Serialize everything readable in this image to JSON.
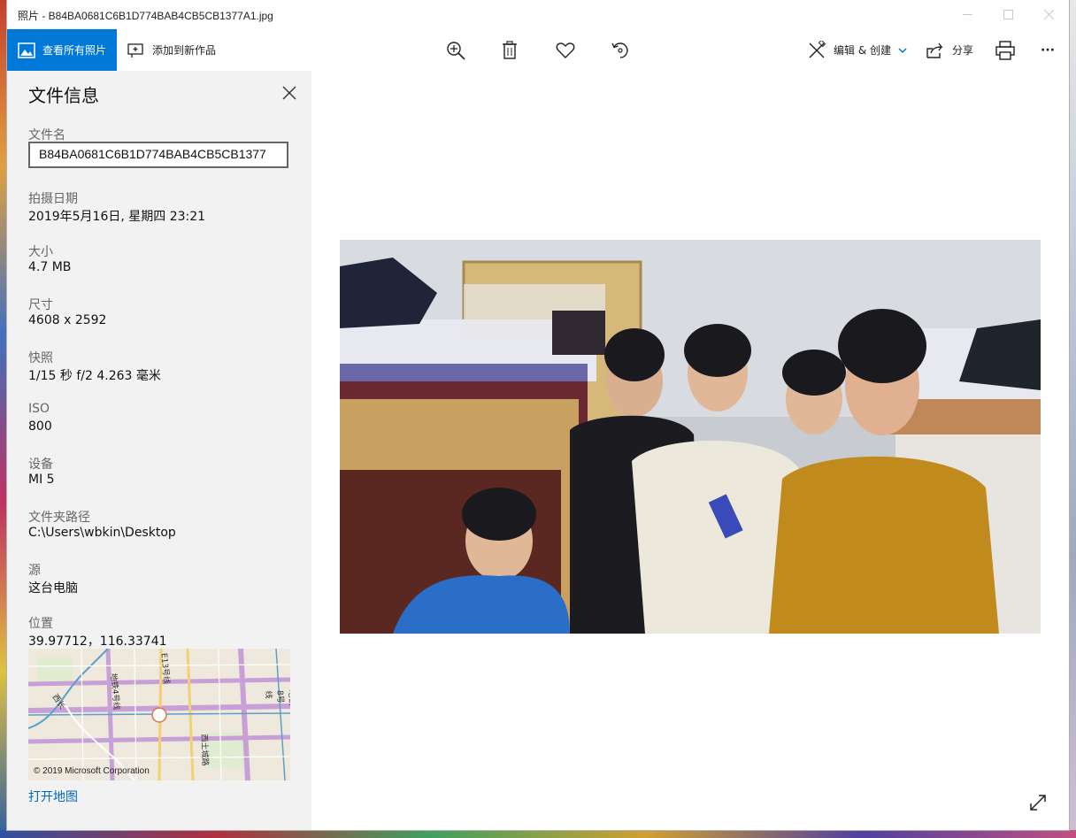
{
  "window": {
    "title": "照片 - B84BA0681C6B1D774BAB4CB5CB1377A1.jpg"
  },
  "toolbar": {
    "view_all_label": "查看所有照片",
    "add_to_creation_label": "添加到新作品",
    "edit_create_label": "编辑 & 创建",
    "share_label": "分享",
    "more_label": "···"
  },
  "file_info": {
    "title": "文件信息",
    "filename_label": "文件名",
    "filename_value": "B84BA0681C6B1D774BAB4CB5CB1377",
    "date_label": "拍摄日期",
    "date_value": "2019年5月16日, 星期四 23:21",
    "size_label": "大小",
    "size_value": "4.7 MB",
    "dimensions_label": "尺寸",
    "dimensions_value": "4608 x 2592",
    "snapshot_label": "快照",
    "snapshot_value": "1/15 秒 f/2 4.263 毫米",
    "iso_label": "ISO",
    "iso_value": "800",
    "device_label": "设备",
    "device_value": "MI 5",
    "folder_label": "文件夹路径",
    "folder_value": "C:\\Users\\wbkin\\Desktop",
    "source_label": "源",
    "source_value": "这台电脑",
    "location_label": "位置",
    "location_value": "39.97712，116.33741",
    "map_copyright": "© 2019 Microsoft Corporation",
    "map_labels": {
      "road_1": "西长",
      "road_2": "地铁4号线",
      "road_3": "E13号线",
      "road_4": "西土城路",
      "road_5": "地铁8号线"
    },
    "open_map_label": "打开地图"
  },
  "colors": {
    "accent": "#0078d7",
    "link": "#0067c0",
    "panel_bg": "#f2f2f2"
  }
}
